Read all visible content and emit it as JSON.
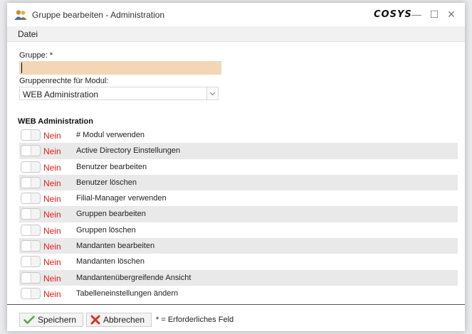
{
  "window": {
    "title": "Gruppe bearbeiten - Administration",
    "brand": "COSYS",
    "controls": {
      "minimize": "—",
      "maximize": "☐",
      "close": "✕"
    }
  },
  "menu": {
    "items": [
      {
        "label": "Datei"
      }
    ]
  },
  "form": {
    "group_label": "Gruppe: *",
    "group_value": "",
    "module_rights_label": "Gruppenrechte für Modul:",
    "module_selected": "WEB Administration"
  },
  "permissions": {
    "section_title": "WEB Administration",
    "items": [
      {
        "state": "Nein",
        "label": "# Modul verwenden"
      },
      {
        "state": "Nein",
        "label": "Active Directory Einstellungen"
      },
      {
        "state": "Nein",
        "label": "Benutzer bearbeiten"
      },
      {
        "state": "Nein",
        "label": "Benutzer löschen"
      },
      {
        "state": "Nein",
        "label": "Filial-Manager verwenden"
      },
      {
        "state": "Nein",
        "label": "Gruppen bearbeiten"
      },
      {
        "state": "Nein",
        "label": "Gruppen löschen"
      },
      {
        "state": "Nein",
        "label": "Mandanten bearbeiten"
      },
      {
        "state": "Nein",
        "label": "Mandanten löschen"
      },
      {
        "state": "Nein",
        "label": "Mandantenübergreifende Ansicht"
      },
      {
        "state": "Nein",
        "label": "Tabelleneinstellungen ändern"
      }
    ]
  },
  "footer": {
    "save_label": "Speichern",
    "cancel_label": "Abbrechen",
    "required_note": "* = Erforderliches Feld"
  },
  "colors": {
    "required_input_bg": "#f3d6b6",
    "state_no": "#e0201b",
    "row_alt": "#e9e9e9"
  },
  "icons": {
    "app": "users-icon",
    "save": "checkmark-icon",
    "cancel": "red-x-icon",
    "dropdown": "chevron-down-icon"
  }
}
